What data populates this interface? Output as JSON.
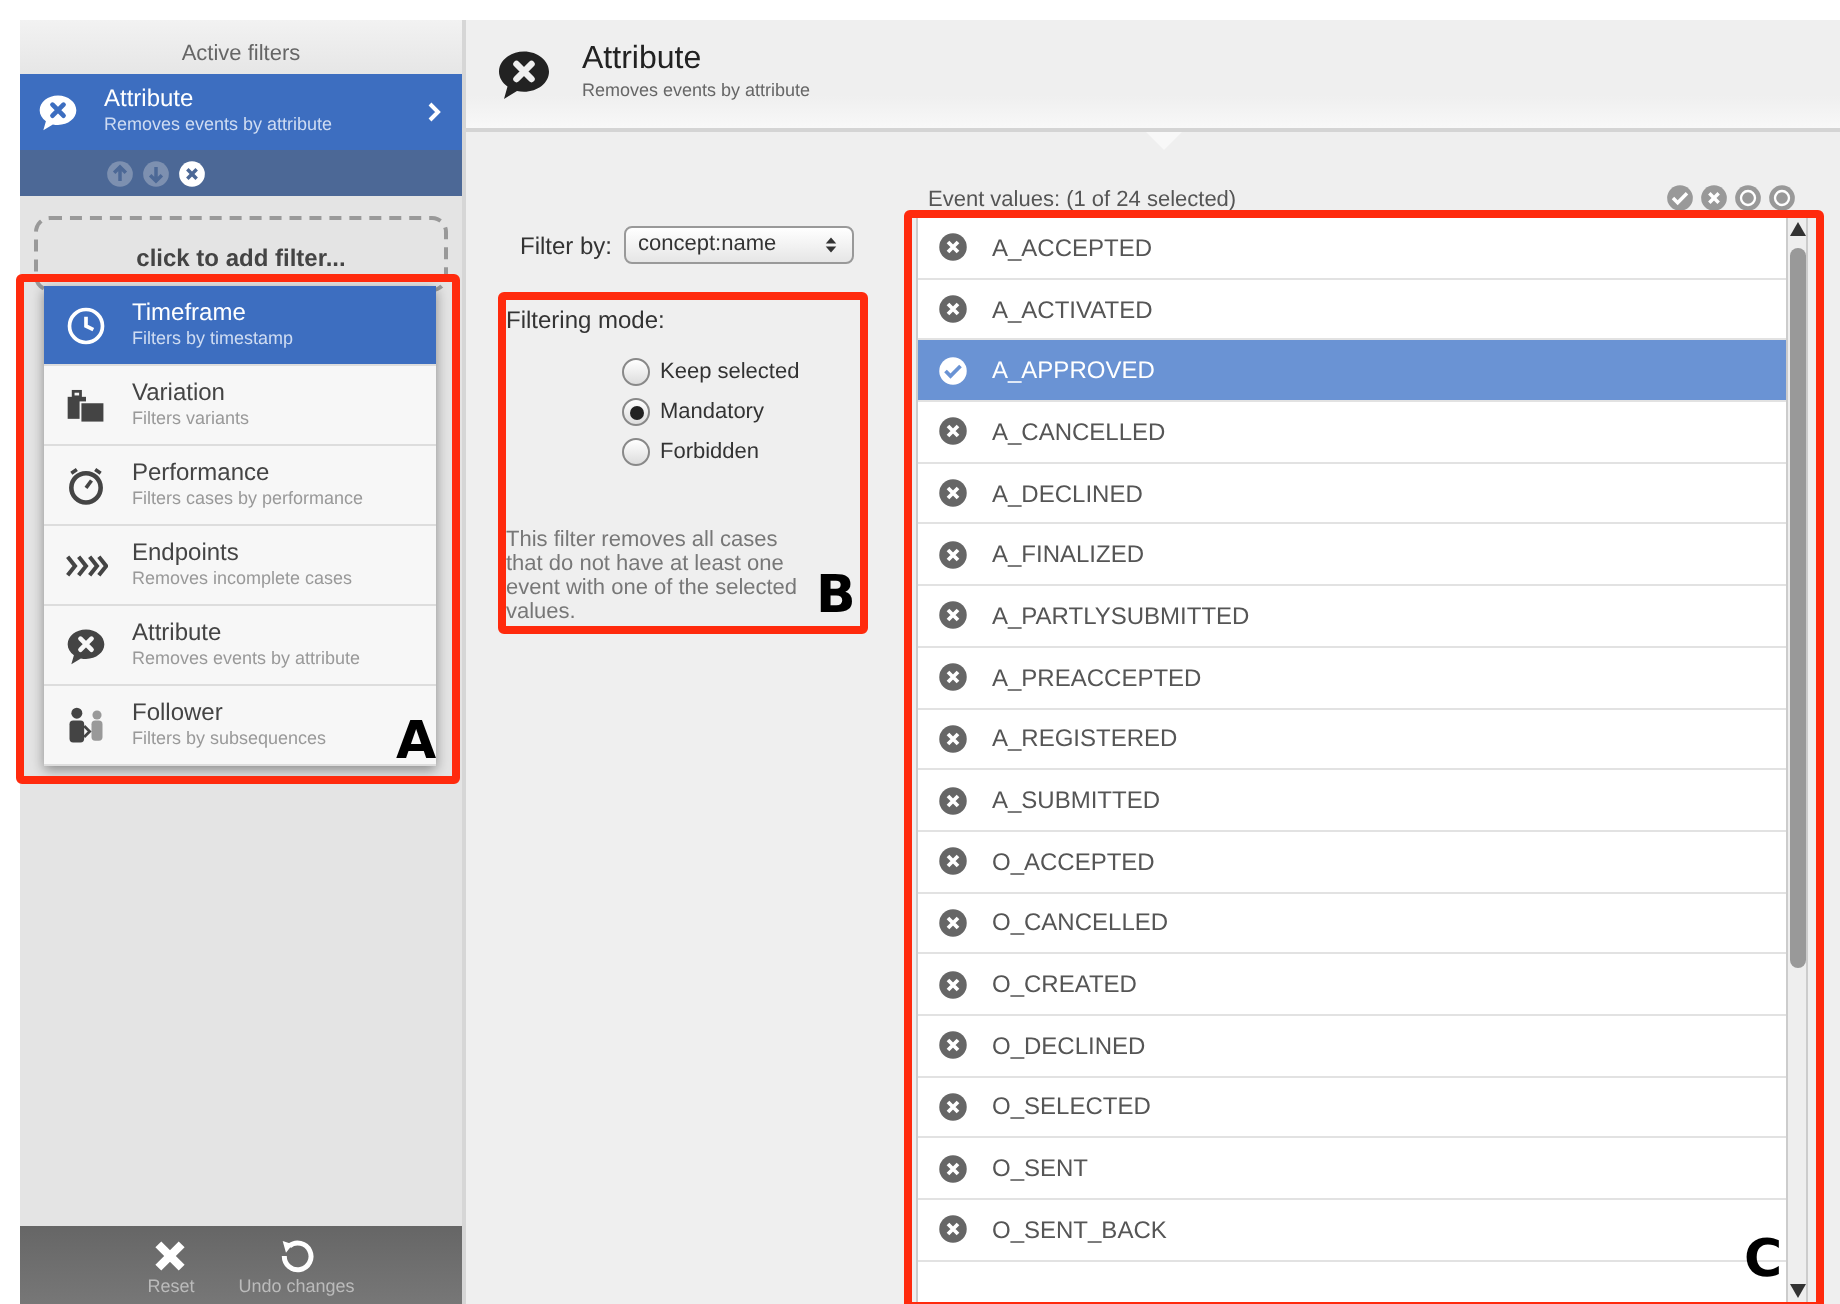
{
  "sidebar": {
    "title": "Active filters",
    "active_filters": [
      {
        "kind": "attribute",
        "title": "Attribute",
        "subtitle": "Removes events by attribute",
        "selected": true
      }
    ],
    "add_filter": "click to add filter...",
    "menu": [
      {
        "kind": "timeframe",
        "title": "Timeframe",
        "subtitle": "Filters by timestamp",
        "selected": true
      },
      {
        "kind": "variation",
        "title": "Variation",
        "subtitle": "Filters variants",
        "selected": false
      },
      {
        "kind": "performance",
        "title": "Performance",
        "subtitle": "Filters cases by performance",
        "selected": false
      },
      {
        "kind": "endpoints",
        "title": "Endpoints",
        "subtitle": "Removes incomplete cases",
        "selected": false
      },
      {
        "kind": "attribute",
        "title": "Attribute",
        "subtitle": "Removes events by attribute",
        "selected": false
      },
      {
        "kind": "follower",
        "title": "Follower",
        "subtitle": "Filters by subsequences",
        "selected": false
      }
    ],
    "footer_buttons": [
      {
        "kind": "reset",
        "label": "Reset"
      },
      {
        "kind": "undo",
        "label": "Undo changes"
      }
    ]
  },
  "header": {
    "title": "Attribute",
    "subtitle": "Removes events by attribute"
  },
  "filter_by": {
    "label": "Filter by:",
    "value": "concept:name"
  },
  "filtering_mode": {
    "label": "Filtering mode:",
    "options": [
      {
        "label": "Keep selected",
        "selected": false
      },
      {
        "label": "Mandatory",
        "selected": true
      },
      {
        "label": "Forbidden",
        "selected": false
      }
    ],
    "description": "This filter removes all cases that do not have at least one event with one of the selected values."
  },
  "event_values": {
    "title": "Event values: (1 of 24 selected)",
    "items": [
      {
        "label": "A_ACCEPTED",
        "selected": false
      },
      {
        "label": "A_ACTIVATED",
        "selected": false
      },
      {
        "label": "A_APPROVED",
        "selected": true
      },
      {
        "label": "A_CANCELLED",
        "selected": false
      },
      {
        "label": "A_DECLINED",
        "selected": false
      },
      {
        "label": "A_FINALIZED",
        "selected": false
      },
      {
        "label": "A_PARTLYSUBMITTED",
        "selected": false
      },
      {
        "label": "A_PREACCEPTED",
        "selected": false
      },
      {
        "label": "A_REGISTERED",
        "selected": false
      },
      {
        "label": "A_SUBMITTED",
        "selected": false
      },
      {
        "label": "O_ACCEPTED",
        "selected": false
      },
      {
        "label": "O_CANCELLED",
        "selected": false
      },
      {
        "label": "O_CREATED",
        "selected": false
      },
      {
        "label": "O_DECLINED",
        "selected": false
      },
      {
        "label": "O_SELECTED",
        "selected": false
      },
      {
        "label": "O_SENT",
        "selected": false
      },
      {
        "label": "O_SENT_BACK",
        "selected": false
      }
    ]
  },
  "annotations": [
    {
      "label": "A"
    },
    {
      "label": "B"
    },
    {
      "label": "C"
    }
  ]
}
